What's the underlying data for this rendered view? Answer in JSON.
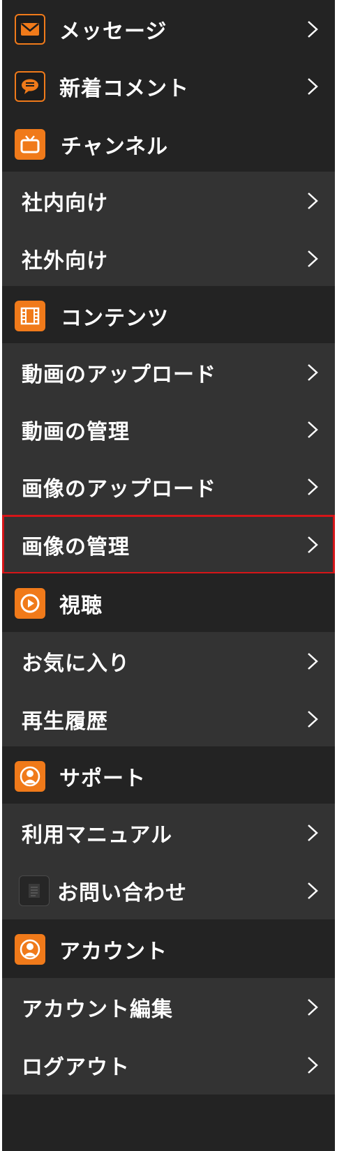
{
  "colors": {
    "background": "#232323",
    "item_background": "#333333",
    "accent": "#f07a1a",
    "text": "#ffffff",
    "selection_outline": "#d61518"
  },
  "menu": {
    "messages": {
      "label": "メッセージ",
      "icon": "envelope-icon"
    },
    "new_comments": {
      "label": "新着コメント",
      "icon": "speech-bubble-icon"
    },
    "channel": {
      "header": "チャンネル",
      "icon": "tv-icon",
      "items": [
        "社内向け",
        "社外向け"
      ]
    },
    "contents": {
      "header": "コンテンツ",
      "icon": "film-icon",
      "items": [
        "動画のアップロード",
        "動画の管理",
        "画像のアップロード",
        "画像の管理"
      ],
      "selected": "画像の管理"
    },
    "viewing": {
      "header": "視聴",
      "icon": "play-icon",
      "items": [
        "お気に入り",
        "再生履歴"
      ]
    },
    "support": {
      "header": "サポート",
      "icon": "person-icon",
      "items": [
        "利用マニュアル",
        "お問い合わせ"
      ],
      "contact_icon": "document-icon"
    },
    "account": {
      "header": "アカウント",
      "icon": "person-icon",
      "items": [
        "アカウント編集",
        "ログアウト"
      ]
    }
  }
}
